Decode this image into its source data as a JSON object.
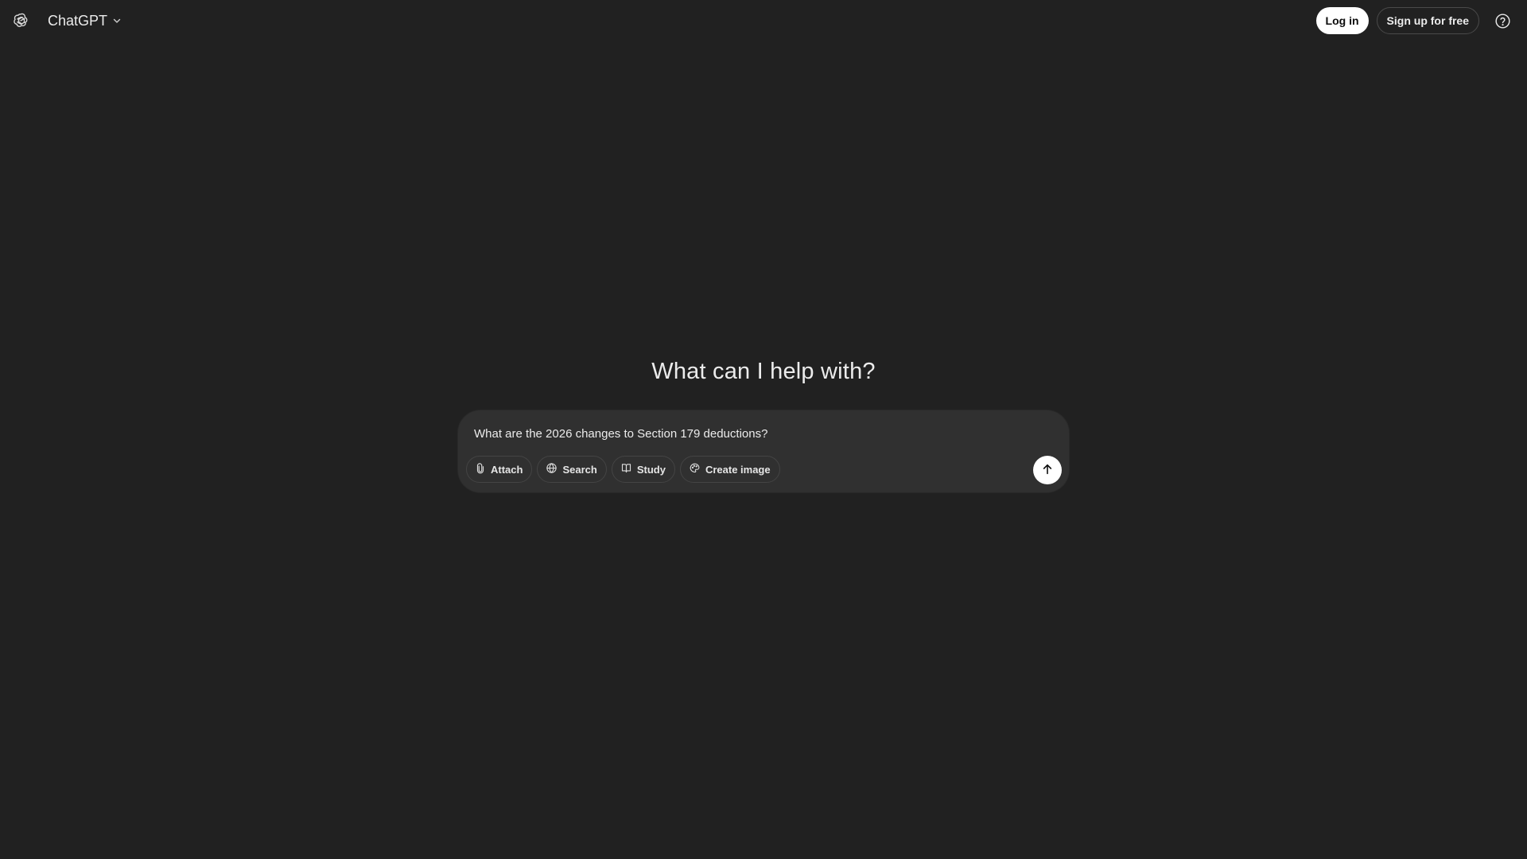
{
  "header": {
    "logo_icon": "openai-logo-icon",
    "model_name": "ChatGPT",
    "model_dropdown_icon": "chevron-down-icon",
    "login_label": "Log in",
    "signup_label": "Sign up for free",
    "help_icon": "question-circle-icon"
  },
  "main": {
    "headline": "What can I help with?"
  },
  "composer": {
    "input_value": "What are the 2026 changes to Section 179 deductions?",
    "tools": [
      {
        "label": "Attach",
        "icon": "paperclip-icon"
      },
      {
        "label": "Search",
        "icon": "globe-icon"
      },
      {
        "label": "Study",
        "icon": "book-icon"
      },
      {
        "label": "Create image",
        "icon": "image-icon"
      }
    ],
    "send_icon": "arrow-up-icon"
  },
  "colors": {
    "background": "#212121",
    "composer_background": "#303030",
    "text": "#ececec",
    "primary_button": "#ffffff"
  }
}
